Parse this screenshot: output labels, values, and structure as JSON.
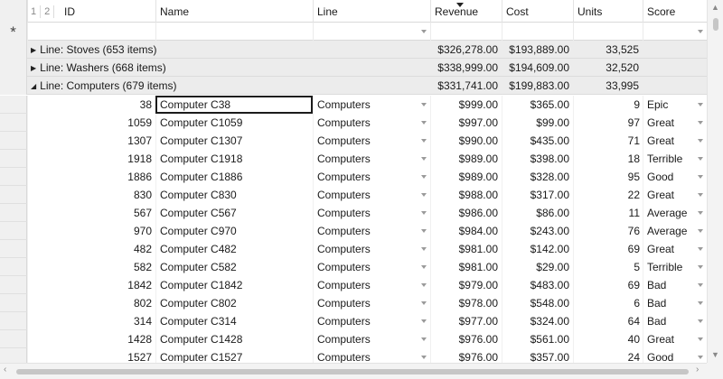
{
  "header": {
    "levels": [
      "1",
      "2"
    ],
    "columns": {
      "id": "ID",
      "name": "Name",
      "line": "Line",
      "revenue": "Revenue",
      "cost": "Cost",
      "units": "Units",
      "score": "Score"
    }
  },
  "filter": {
    "new_row_symbol": "*"
  },
  "groups": [
    {
      "label": "Line: Stoves (653 items)",
      "revenue": "$326,278.00",
      "cost": "$193,889.00",
      "units": "33,525",
      "expanded": false
    },
    {
      "label": "Line: Washers (668 items)",
      "revenue": "$338,999.00",
      "cost": "$194,609.00",
      "units": "32,520",
      "expanded": false
    },
    {
      "label": "Line: Computers (679 items)",
      "revenue": "$331,741.00",
      "cost": "$199,883.00",
      "units": "33,995",
      "expanded": true
    }
  ],
  "rows": [
    {
      "id": "38",
      "name": "Computer C38",
      "line": "Computers",
      "revenue": "$999.00",
      "cost": "$365.00",
      "units": "9",
      "score": "Epic"
    },
    {
      "id": "1059",
      "name": "Computer C1059",
      "line": "Computers",
      "revenue": "$997.00",
      "cost": "$99.00",
      "units": "97",
      "score": "Great"
    },
    {
      "id": "1307",
      "name": "Computer C1307",
      "line": "Computers",
      "revenue": "$990.00",
      "cost": "$435.00",
      "units": "71",
      "score": "Great"
    },
    {
      "id": "1918",
      "name": "Computer C1918",
      "line": "Computers",
      "revenue": "$989.00",
      "cost": "$398.00",
      "units": "18",
      "score": "Terrible"
    },
    {
      "id": "1886",
      "name": "Computer C1886",
      "line": "Computers",
      "revenue": "$989.00",
      "cost": "$328.00",
      "units": "95",
      "score": "Good"
    },
    {
      "id": "830",
      "name": "Computer C830",
      "line": "Computers",
      "revenue": "$988.00",
      "cost": "$317.00",
      "units": "22",
      "score": "Great"
    },
    {
      "id": "567",
      "name": "Computer C567",
      "line": "Computers",
      "revenue": "$986.00",
      "cost": "$86.00",
      "units": "11",
      "score": "Average"
    },
    {
      "id": "970",
      "name": "Computer C970",
      "line": "Computers",
      "revenue": "$984.00",
      "cost": "$243.00",
      "units": "76",
      "score": "Average"
    },
    {
      "id": "482",
      "name": "Computer C482",
      "line": "Computers",
      "revenue": "$981.00",
      "cost": "$142.00",
      "units": "69",
      "score": "Great"
    },
    {
      "id": "582",
      "name": "Computer C582",
      "line": "Computers",
      "revenue": "$981.00",
      "cost": "$29.00",
      "units": "5",
      "score": "Terrible"
    },
    {
      "id": "1842",
      "name": "Computer C1842",
      "line": "Computers",
      "revenue": "$979.00",
      "cost": "$483.00",
      "units": "69",
      "score": "Bad"
    },
    {
      "id": "802",
      "name": "Computer C802",
      "line": "Computers",
      "revenue": "$978.00",
      "cost": "$548.00",
      "units": "6",
      "score": "Bad"
    },
    {
      "id": "314",
      "name": "Computer C314",
      "line": "Computers",
      "revenue": "$977.00",
      "cost": "$324.00",
      "units": "64",
      "score": "Bad"
    },
    {
      "id": "1428",
      "name": "Computer C1428",
      "line": "Computers",
      "revenue": "$976.00",
      "cost": "$561.00",
      "units": "40",
      "score": "Great"
    },
    {
      "id": "1527",
      "name": "Computer C1527",
      "line": "Computers",
      "revenue": "$976.00",
      "cost": "$357.00",
      "units": "24",
      "score": "Good"
    }
  ],
  "icons": {
    "expand": "triangle-right-icon",
    "collapse": "triangle-down-icon",
    "dropdown": "chevron-down-icon",
    "sort": "sort-descending-icon"
  }
}
